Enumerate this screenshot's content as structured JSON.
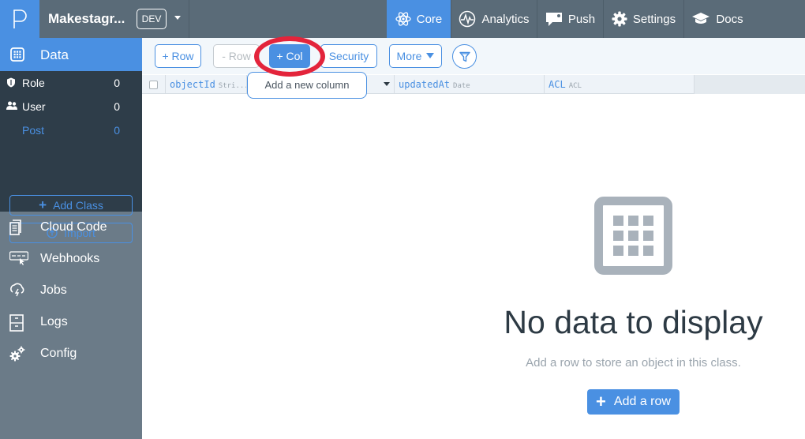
{
  "header": {
    "app_name": "Makestagr...",
    "env_badge": "DEV",
    "nav": [
      {
        "label": "Core",
        "active": true
      },
      {
        "label": "Analytics",
        "active": false
      },
      {
        "label": "Push",
        "active": false
      },
      {
        "label": "Settings",
        "active": false
      },
      {
        "label": "Docs",
        "active": false
      }
    ]
  },
  "sidebar": {
    "data_label": "Data",
    "classes": [
      {
        "label": "Role",
        "count": "0",
        "icon": "shield-icon"
      },
      {
        "label": "User",
        "count": "0",
        "icon": "users-icon"
      },
      {
        "label": "Post",
        "count": "0",
        "icon": "",
        "selected": true
      }
    ],
    "add_class_label": "Add Class",
    "import_label": "Import",
    "items": [
      {
        "label": "Cloud Code",
        "icon": "document-icon"
      },
      {
        "label": "Webhooks",
        "icon": "webhook-icon"
      },
      {
        "label": "Jobs",
        "icon": "jobs-icon"
      },
      {
        "label": "Logs",
        "icon": "logs-icon"
      },
      {
        "label": "Config",
        "icon": "gears-icon"
      }
    ]
  },
  "toolbar": {
    "add_row": "+ Row",
    "remove_row": "- Row",
    "add_col": "+ Col",
    "security": "Security",
    "more": "More",
    "tooltip": "Add a new column"
  },
  "table": {
    "columns": [
      {
        "name": "objectId",
        "type": "Stri..."
      },
      {
        "name": "updatedAt",
        "type": "Date"
      },
      {
        "name": "ACL",
        "type": "ACL"
      }
    ]
  },
  "empty": {
    "title": "No data to display",
    "subtitle": "Add a row to store an object in this class.",
    "button": "Add a row"
  },
  "colors": {
    "accent": "#4a90e2",
    "topbar": "#5a6b78",
    "sidebar": "#6b7b88",
    "sidebar_dark": "#2e3d49",
    "highlight": "#e3243b"
  }
}
